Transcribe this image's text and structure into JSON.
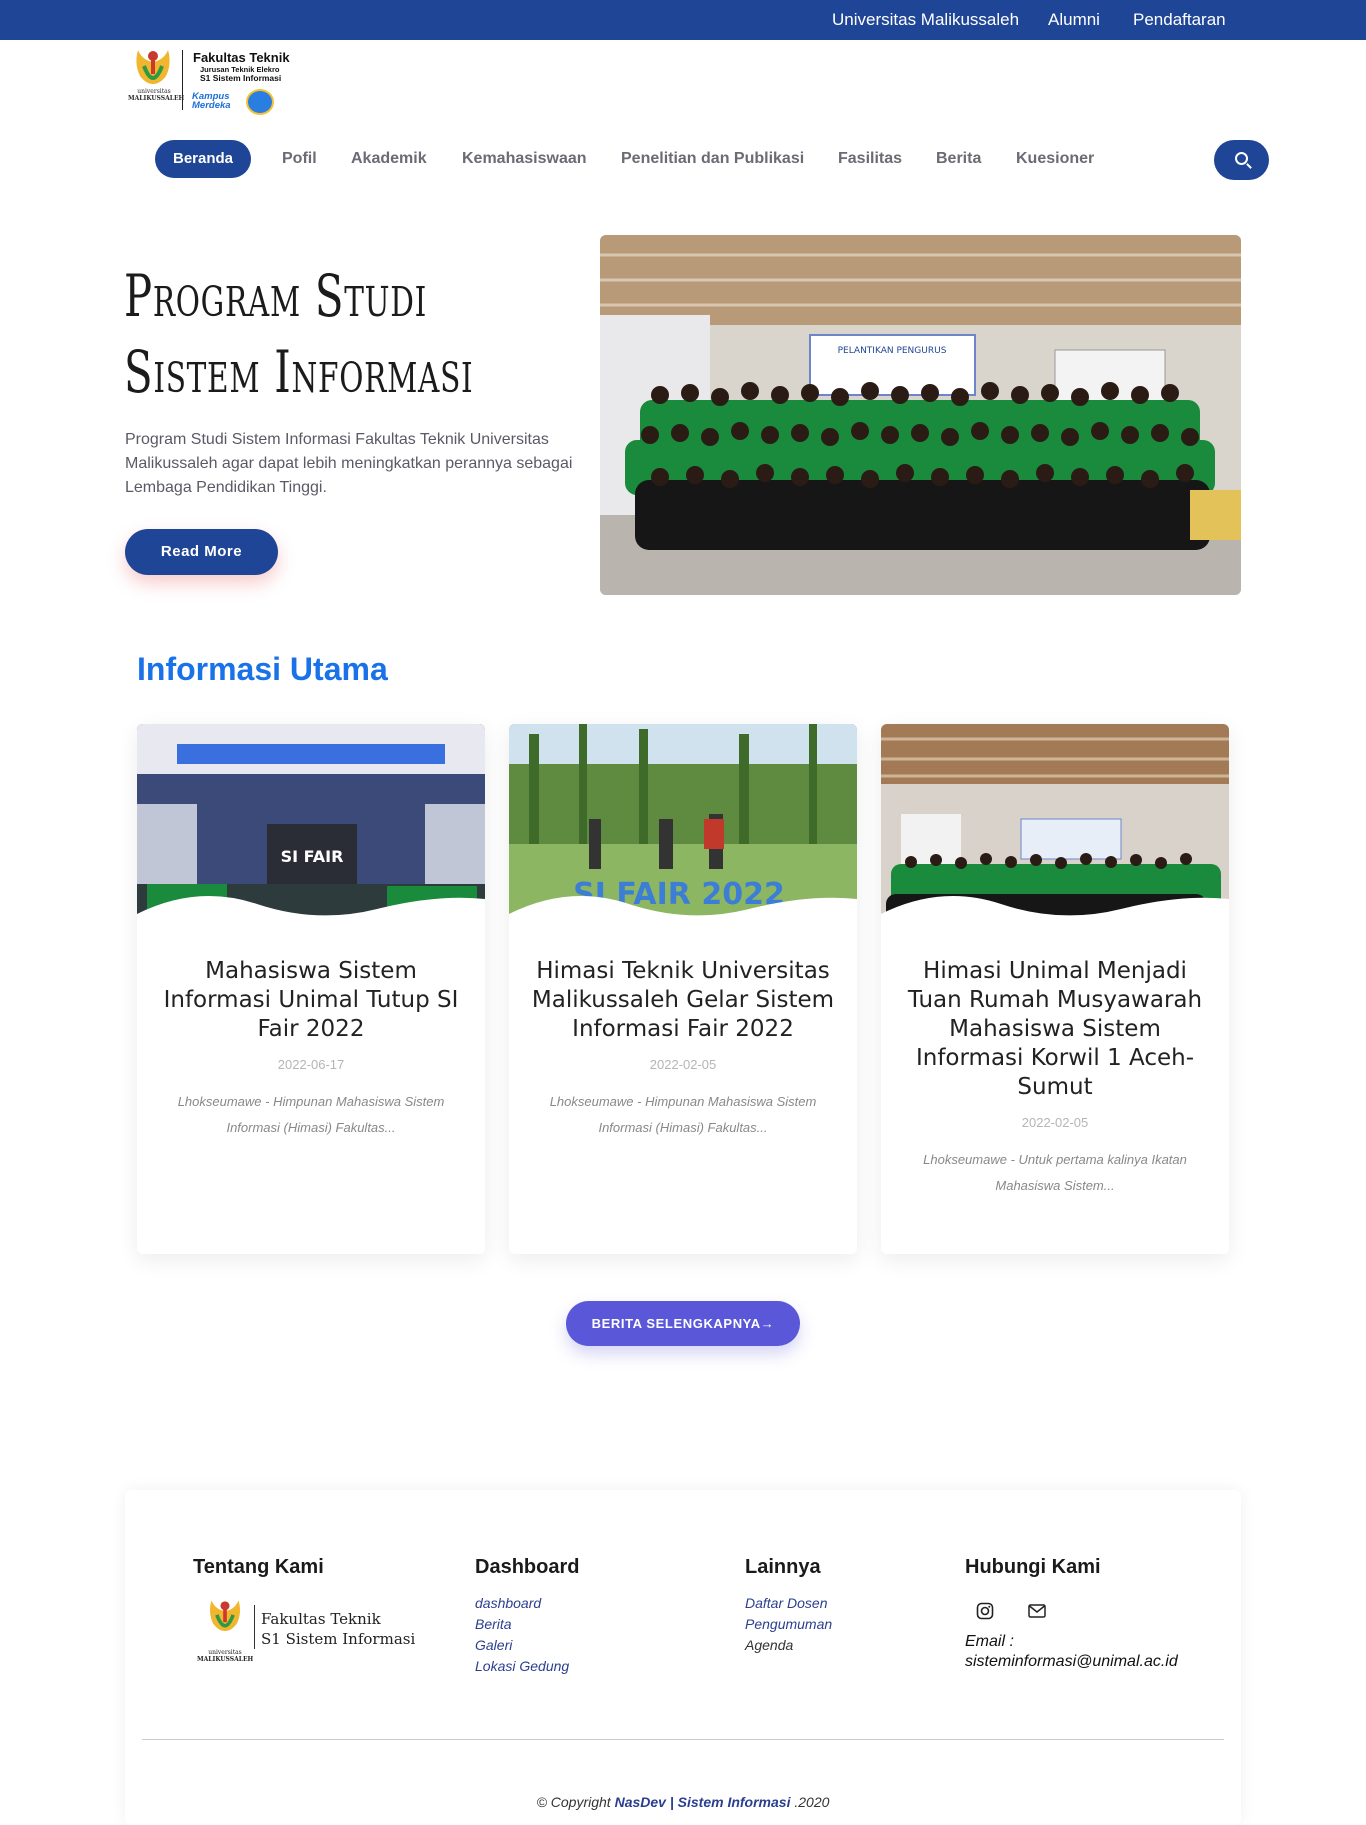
{
  "topbar": {
    "links": [
      "Universitas Malikussaleh",
      "Alumni",
      "Pendaftaran"
    ]
  },
  "logo": {
    "university_line1": "universitas",
    "university_line2": "MALIKUSSALEH",
    "faculty": "Fakultas Teknik",
    "department": "Jurusan Teknik Elekro",
    "program": "S1 Sistem Informasi",
    "badge_line1": "Kampus",
    "badge_line2": "Merdeka"
  },
  "nav": {
    "items": [
      "Beranda",
      "Pofil",
      "Akademik",
      "Kemahasiswaan",
      "Penelitian dan Publikasi",
      "Fasilitas",
      "Berita",
      "Kuesioner"
    ],
    "active": "Beranda",
    "search_icon": "search-icon"
  },
  "hero": {
    "title_line1": "Program Studi",
    "title_line2": "Sistem Informasi",
    "description": "Program Studi Sistem Informasi Fakultas Teknik Universitas Malikussaleh agar dapat lebih meningkatkan perannya sebagai Lembaga Pendidikan Tinggi.",
    "button": "Read More",
    "banner_text": "PELANTIKAN PENGURUS"
  },
  "section": {
    "title": "Informasi Utama"
  },
  "cards": [
    {
      "title": "Mahasiswa Sistem Informasi Unimal Tutup SI Fair 2022",
      "date": "2022-06-17",
      "excerpt": "Lhokseumawe - Himpunan Mahasiswa Sistem Informasi (Himasi) Fakultas...",
      "image_text": "SI FAIR"
    },
    {
      "title": "Himasi Teknik Universitas Malikussaleh Gelar Sistem Informasi Fair 2022",
      "date": "2022-02-05",
      "excerpt": "Lhokseumawe - Himpunan Mahasiswa Sistem Informasi (Himasi) Fakultas...",
      "image_text": "SI FAIR 2022"
    },
    {
      "title": "Himasi Unimal Menjadi Tuan Rumah Musyawarah Mahasiswa Sistem Informasi Korwil 1 Aceh-Sumut",
      "date": "2022-02-05",
      "excerpt": "Lhokseumawe - Untuk pertama kalinya Ikatan Mahasiswa Sistem...",
      "image_text": ""
    }
  ],
  "more_button": "BERITA SELENGKAPNYA→",
  "footer": {
    "about_title": "Tentang Kami",
    "about_logo_line1": "Fakultas Teknik",
    "about_logo_line2": "S1 Sistem Informasi",
    "about_logo_uni1": "universitas",
    "about_logo_uni2": "MALIKUSSALEH",
    "dashboard_title": "Dashboard",
    "dashboard_links": [
      "dashboard",
      "Berita",
      "Galeri",
      "Lokasi Gedung"
    ],
    "other_title": "Lainnya",
    "other_links": [
      "Daftar Dosen",
      "Pengumuman",
      "Agenda"
    ],
    "contact_title": "Hubungi Kami",
    "social_icons": [
      "instagram-icon",
      "mail-icon"
    ],
    "email_label": "Email :",
    "email": "sisteminformasi@unimal.ac.id",
    "copyright_prefix": "© Copyright",
    "copyright_brand": "NasDev | Sistem Informasi",
    "copyright_year": ".2020"
  },
  "colors": {
    "primary": "#1f4596",
    "accent_title": "#1a72e8",
    "more_button": "#5a57d8",
    "jacket_green": "#1a8a3c"
  }
}
